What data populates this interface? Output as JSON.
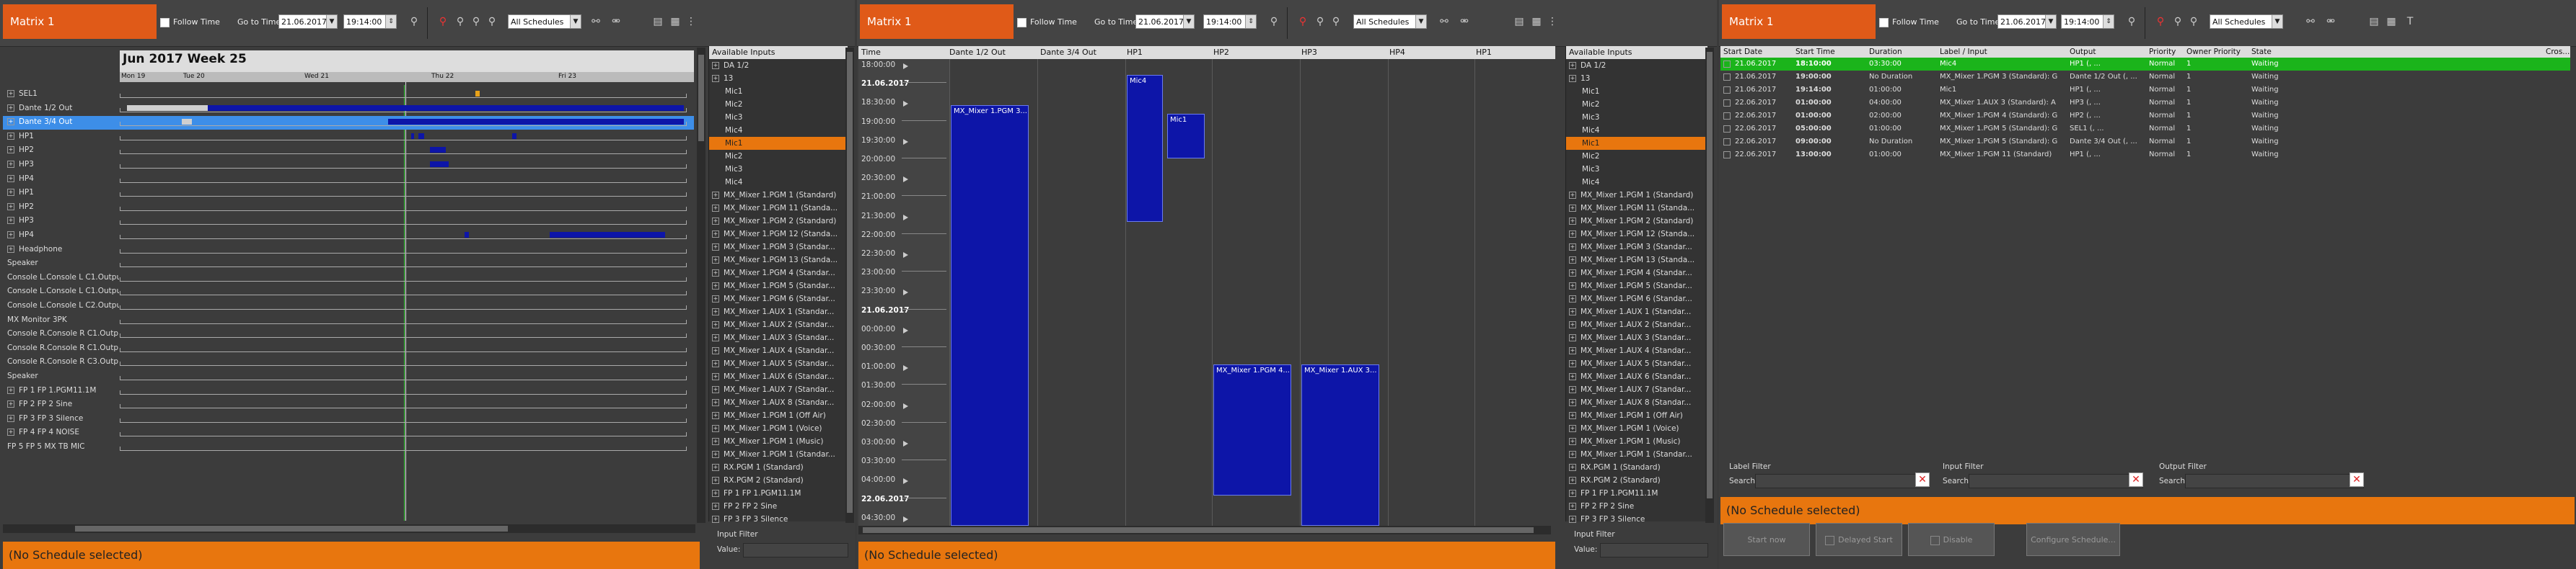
{
  "common": {
    "title": "Matrix 1",
    "follow_time": "Follow Time",
    "goto_label": "Go to Time:",
    "date": "21.06.2017",
    "time": "19:14:00",
    "schedules": "All Schedules",
    "no_schedule": "(No Schedule selected)",
    "available_inputs": "Available Inputs",
    "input_filter": "Input Filter",
    "value_label": "Value:"
  },
  "inputs_list": [
    {
      "label": "DA 1/2",
      "kind": "group"
    },
    {
      "label": "13",
      "kind": "group"
    },
    {
      "label": "Mic1",
      "kind": "child"
    },
    {
      "label": "Mic2",
      "kind": "child"
    },
    {
      "label": "Mic3",
      "kind": "child"
    },
    {
      "label": "Mic4",
      "kind": "child"
    },
    {
      "label": "Mic1",
      "kind": "child",
      "selected": true
    },
    {
      "label": "Mic2",
      "kind": "child"
    },
    {
      "label": "Mic3",
      "kind": "child"
    },
    {
      "label": "Mic4",
      "kind": "child"
    },
    {
      "label": "MX_Mixer 1.PGM 1 (Standard)",
      "kind": "group"
    },
    {
      "label": "MX_Mixer 1.PGM 11 (Standa...",
      "kind": "group"
    },
    {
      "label": "MX_Mixer 1.PGM 2 (Standard)",
      "kind": "group"
    },
    {
      "label": "MX_Mixer 1.PGM 12 (Standa...",
      "kind": "group"
    },
    {
      "label": "MX_Mixer 1.PGM 3 (Standar...",
      "kind": "group"
    },
    {
      "label": "MX_Mixer 1.PGM 13 (Standa...",
      "kind": "group"
    },
    {
      "label": "MX_Mixer 1.PGM 4 (Standar...",
      "kind": "group"
    },
    {
      "label": "MX_Mixer 1.PGM 5 (Standar...",
      "kind": "group"
    },
    {
      "label": "MX_Mixer 1.PGM 6 (Standar...",
      "kind": "group"
    },
    {
      "label": "MX_Mixer 1.AUX 1 (Standar...",
      "kind": "group"
    },
    {
      "label": "MX_Mixer 1.AUX 2 (Standar...",
      "kind": "group"
    },
    {
      "label": "MX_Mixer 1.AUX 3 (Standar...",
      "kind": "group"
    },
    {
      "label": "MX_Mixer 1.AUX 4 (Standar...",
      "kind": "group"
    },
    {
      "label": "MX_Mixer 1.AUX 5 (Standar...",
      "kind": "group"
    },
    {
      "label": "MX_Mixer 1.AUX 6 (Standar...",
      "kind": "group"
    },
    {
      "label": "MX_Mixer 1.AUX 7 (Standar...",
      "kind": "group"
    },
    {
      "label": "MX_Mixer 1.AUX 8 (Standar...",
      "kind": "group"
    },
    {
      "label": "MX_Mixer 1.PGM 1 (Off Air)",
      "kind": "group"
    },
    {
      "label": "MX_Mixer 1.PGM 1 (Voice)",
      "kind": "group"
    },
    {
      "label": "MX_Mixer 1.PGM 1 (Music)",
      "kind": "group"
    },
    {
      "label": "MX_Mixer 1.PGM 1 (Standar...",
      "kind": "group"
    },
    {
      "label": "RX.PGM 1 (Standard)",
      "kind": "group"
    },
    {
      "label": "RX.PGM 2 (Standard)",
      "kind": "group"
    },
    {
      "label": "FP 1 FP 1.PGM11.1M",
      "kind": "group"
    },
    {
      "label": "FP 2 FP 2 Sine",
      "kind": "group"
    },
    {
      "label": "FP 3 FP 3 Silence",
      "kind": "group"
    }
  ],
  "timeline": {
    "heading": "Jun 2017 Week 25",
    "days": [
      "Mon 19",
      "Tue 20",
      "Wed 21",
      "Thu 22",
      "Fri 23"
    ],
    "rows": [
      {
        "label": "SEL1",
        "box": "+"
      },
      {
        "label": "Dante 1/2 Out",
        "box": "+"
      },
      {
        "label": "Dante 3/4 Out",
        "box": "+",
        "selected": true
      },
      {
        "label": "HP1",
        "box": "+"
      },
      {
        "label": "HP2",
        "box": "+"
      },
      {
        "label": "HP3",
        "box": "+"
      },
      {
        "label": "HP4",
        "box": "+"
      },
      {
        "label": "HP1",
        "box": "+"
      },
      {
        "label": "HP2",
        "box": "+"
      },
      {
        "label": "HP3",
        "box": "+"
      },
      {
        "label": "HP4",
        "box": "+"
      },
      {
        "label": "Headphone",
        "box": "+"
      },
      {
        "label": "Speaker",
        "box": ""
      },
      {
        "label": "Console L.Console L C1.Outpu",
        "box": ""
      },
      {
        "label": "Console L.Console L C1.Outpu",
        "box": ""
      },
      {
        "label": "Console L.Console L C2.Outpu",
        "box": ""
      },
      {
        "label": "MX Monitor 3PK",
        "box": ""
      },
      {
        "label": "Console R.Console R C1.Outp",
        "box": ""
      },
      {
        "label": "Console R.Console R C1.Outp",
        "box": ""
      },
      {
        "label": "Console R.Console R C3.Outp",
        "box": ""
      },
      {
        "label": "Speaker",
        "box": ""
      },
      {
        "label": "FP 1 FP 1.PGM11.1M",
        "box": "+"
      },
      {
        "label": "FP 2 FP 2 Sine",
        "box": "+"
      },
      {
        "label": "FP 3 FP 3 Silence",
        "box": "+"
      },
      {
        "label": "FP 4 FP 4 NOISE",
        "box": "+"
      },
      {
        "label": "FP 5 FP 5 MX TB MIC",
        "box": ""
      }
    ]
  },
  "sched": {
    "time_hdr": "Time",
    "cols": [
      "Dante 1/2 Out",
      "Dante 3/4 Out",
      "HP1",
      "HP2",
      "HP3",
      "HP4",
      "HP1"
    ],
    "times": [
      {
        "t": "18:00:00"
      },
      {
        "t": "21.06.2017",
        "bold": true
      },
      {
        "t": "18:30:00"
      },
      {
        "t": "19:00:00"
      },
      {
        "t": "19:30:00"
      },
      {
        "t": "20:00:00"
      },
      {
        "t": "20:30:00"
      },
      {
        "t": "21:00:00"
      },
      {
        "t": "21:30:00"
      },
      {
        "t": "22:00:00"
      },
      {
        "t": "22:30:00"
      },
      {
        "t": "23:00:00"
      },
      {
        "t": "23:30:00"
      },
      {
        "t": "21.06.2017",
        "bold": true
      },
      {
        "t": "00:00:00"
      },
      {
        "t": "00:30:00"
      },
      {
        "t": "01:00:00"
      },
      {
        "t": "01:30:00"
      },
      {
        "t": "02:00:00"
      },
      {
        "t": "02:30:00"
      },
      {
        "t": "03:00:00"
      },
      {
        "t": "03:30:00"
      },
      {
        "t": "04:00:00"
      },
      {
        "t": "22.06.2017",
        "bold": true
      },
      {
        "t": "04:30:00"
      }
    ],
    "blocks": [
      {
        "label": "MX_Mixer 1.PGM 3..."
      },
      {
        "label": "Mic4"
      },
      {
        "label": "Mic1"
      },
      {
        "label": "MX_Mixer 1.PGM 4..."
      },
      {
        "label": "MX_Mixer 1.AUX 3..."
      }
    ]
  },
  "list": {
    "headers": [
      "Start Date",
      "Start Time",
      "Duration",
      "Label / Input",
      "Output",
      "Priority",
      "Owner Priority",
      "State",
      "Cros..."
    ],
    "rows": [
      [
        "21.06.2017",
        "18:10:00",
        "03:30:00",
        "Mic4",
        "HP1 (, ...",
        "Normal",
        "1",
        "Waiting"
      ],
      [
        "21.06.2017",
        "19:00:00",
        "No Duration",
        "MX_Mixer 1.PGM 3 (Standard): G",
        "Dante 1/2 Out (, ...",
        "Normal",
        "1",
        "Waiting"
      ],
      [
        "21.06.2017",
        "19:14:00",
        "01:00:00",
        "Mic1",
        "HP1 (, ...",
        "Normal",
        "1",
        "Waiting"
      ],
      [
        "22.06.2017",
        "01:00:00",
        "04:00:00",
        "MX_Mixer 1.AUX 3 (Standard): A",
        "HP3 (, ...",
        "Normal",
        "1",
        "Waiting"
      ],
      [
        "22.06.2017",
        "01:00:00",
        "02:00:00",
        "MX_Mixer 1.PGM 4 (Standard): G",
        "HP2 (, ...",
        "Normal",
        "1",
        "Waiting"
      ],
      [
        "22.06.2017",
        "05:00:00",
        "01:00:00",
        "MX_Mixer 1.PGM 5 (Standard): G",
        "SEL1 (, ...",
        "Normal",
        "1",
        "Waiting"
      ],
      [
        "22.06.2017",
        "09:00:00",
        "No Duration",
        "MX_Mixer 1.PGM 5 (Standard): G",
        "Dante 3/4 Out (, ...",
        "Normal",
        "1",
        "Waiting"
      ],
      [
        "22.06.2017",
        "13:00:00",
        "01:00:00",
        "MX_Mixer 1.PGM 11 (Standard)",
        "HP1 (, ...",
        "Normal",
        "1",
        "Waiting"
      ]
    ],
    "label_filter": "Label Filter",
    "input_filter": "Input Filter",
    "output_filter": "Output Filter",
    "search": "Search:",
    "buttons": {
      "start_now": "Start now",
      "delayed_start": "Delayed Start",
      "disable": "Disable",
      "configure": "Configure Schedule..."
    }
  }
}
